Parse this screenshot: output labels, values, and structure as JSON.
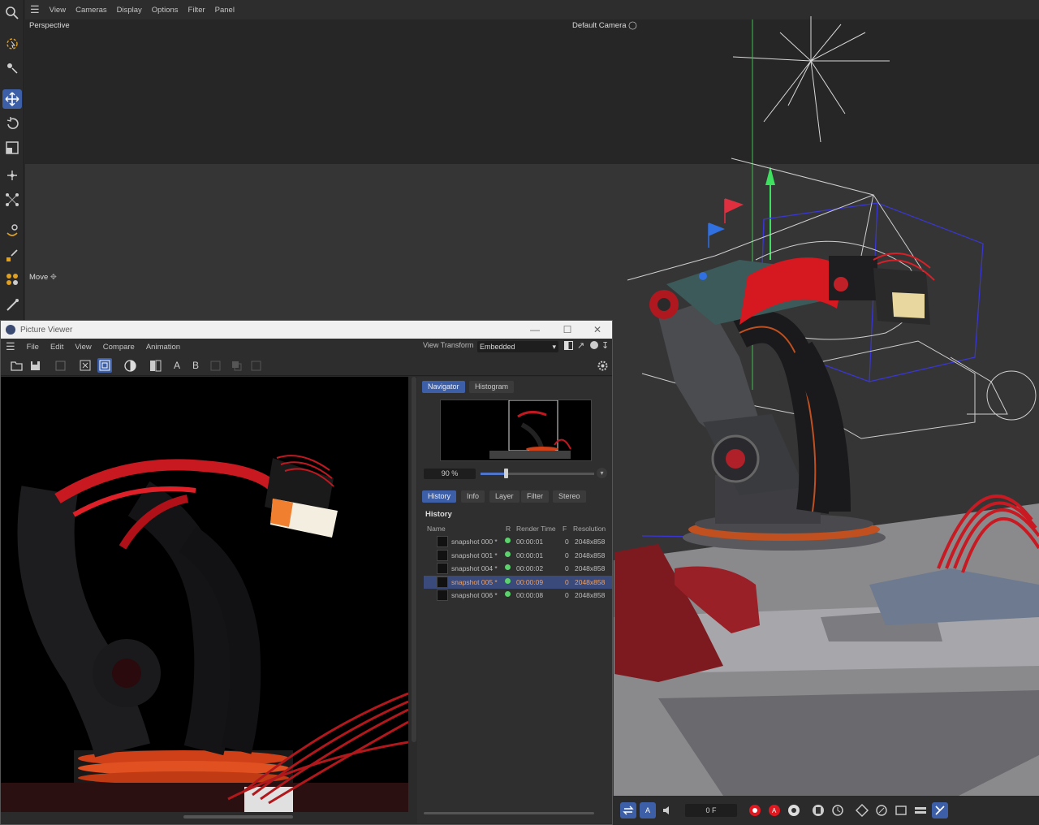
{
  "viewport": {
    "menu": [
      "View",
      "Cameras",
      "Display",
      "Options",
      "Filter",
      "Panel"
    ],
    "view_label": "Perspective",
    "camera_label": "Default Camera",
    "tool_label": "Move"
  },
  "toolstrip": {
    "tools": [
      "search-icon",
      "live-selection-icon",
      "tweak-icon",
      "move-icon",
      "rotate-icon",
      "scale-icon",
      "axis-move-icon",
      "points-icon",
      "paint-icon",
      "knife-icon",
      "objects-icon",
      "brush-icon"
    ]
  },
  "timeline": {
    "frame": "0 F",
    "buttons": [
      "loop-icon",
      "auto-icon",
      "sound-icon",
      "record-icon",
      "autokey-icon",
      "keyframe-icon",
      "motion-icon",
      "timeline-icon",
      "pos-icon",
      "rot-icon",
      "scale-icon",
      "param-icon",
      "pla-icon",
      "snap-icon"
    ]
  },
  "picture_viewer": {
    "title": "Picture Viewer",
    "menu": [
      "File",
      "Edit",
      "View",
      "Compare",
      "Animation"
    ],
    "view_transform_label": "View Transform",
    "view_transform_value": "Embedded",
    "tool_letters": [
      "A",
      "B"
    ],
    "nav_tabs": [
      "Navigator",
      "Histogram"
    ],
    "zoom": "90 %",
    "zoom_fraction": 0.2,
    "info_tabs": [
      "History",
      "Info",
      "Layer",
      "Filter",
      "Stereo"
    ],
    "history_heading": "History",
    "history_columns": [
      "Name",
      "R",
      "Render Time",
      "F",
      "Resolution"
    ],
    "history_rows": [
      {
        "name": "snapshot 000 *",
        "time": "00:00:01",
        "f": "0",
        "res": "2048x858"
      },
      {
        "name": "snapshot 001 *",
        "time": "00:00:01",
        "f": "0",
        "res": "2048x858"
      },
      {
        "name": "snapshot 004 *",
        "time": "00:00:02",
        "f": "0",
        "res": "2048x858"
      },
      {
        "name": "snapshot 005 *",
        "time": "00:00:09",
        "f": "0",
        "res": "2048x858"
      },
      {
        "name": "snapshot 006 *",
        "time": "00:00:08",
        "f": "0",
        "res": "2048x858"
      }
    ],
    "selected_row": 3
  },
  "colors": {
    "accent": "#3d5fa8",
    "render_red": "#e01820",
    "status_green": "#5bd26b"
  }
}
